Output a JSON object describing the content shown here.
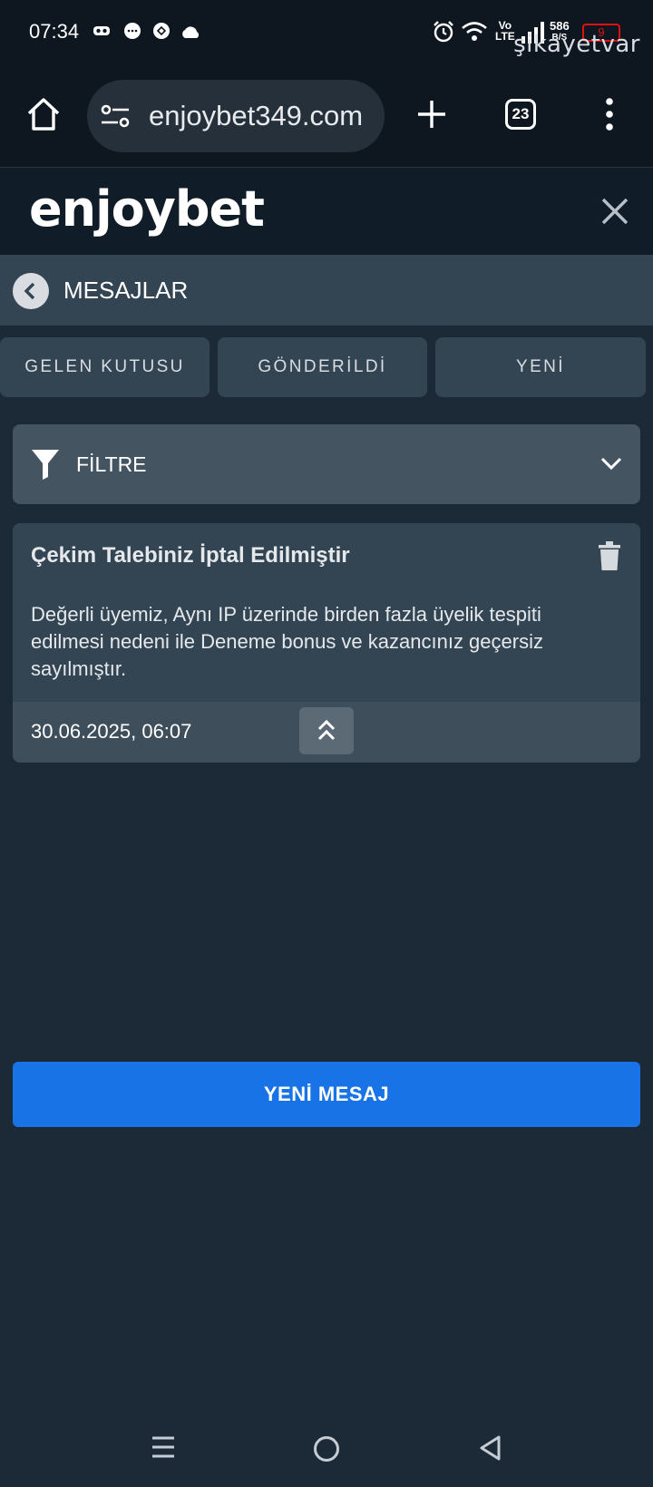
{
  "status_bar": {
    "time": "07:34",
    "net_speed": "586",
    "net_unit": "B/S",
    "volte": "Vo",
    "lte": "LTE",
    "battery": "9",
    "watermark": "şikayetvar"
  },
  "browser": {
    "url": "enjoybet349.com",
    "tab_count": "23"
  },
  "site": {
    "logo_text": "enjoybet"
  },
  "messages_page": {
    "title": "MESAJLAR",
    "tabs": [
      {
        "label": "GELEN KUTUSU"
      },
      {
        "label": "GÖNDERİLDİ"
      },
      {
        "label": "YENİ"
      }
    ],
    "filter_label": "FİLTRE",
    "messages": [
      {
        "title": "Çekim Talebiniz İptal Edilmiştir",
        "body": "Değerli üyemiz, Aynı IP üzerinde birden fazla üyelik tespiti edilmesi nedeni ile Deneme bonus ve kazancınız geçersiz sayılmıştır.",
        "date": "30.06.2025, 06:07"
      }
    ],
    "new_message_label": "YENİ MESAJ"
  },
  "colors": {
    "accent": "#1773e6",
    "page_bg": "#1c2a38",
    "panel": "#334453"
  }
}
